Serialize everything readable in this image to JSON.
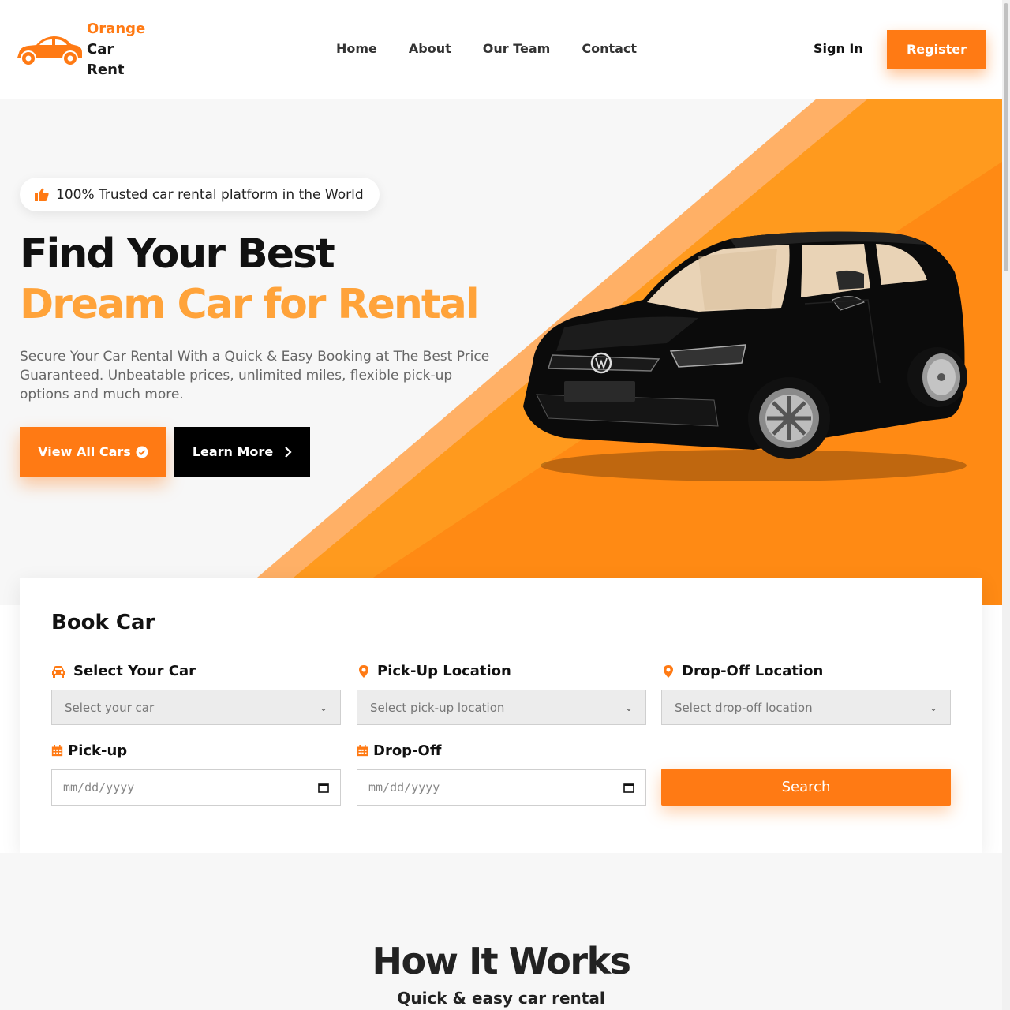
{
  "brand": {
    "line1": "Orange",
    "line2": "Car",
    "line3": "Rent",
    "accent": "#ff7a14"
  },
  "nav": {
    "items": [
      "Home",
      "About",
      "Our Team",
      "Contact"
    ],
    "sign_in": "Sign In",
    "register": "Register"
  },
  "hero": {
    "badge": "100% Trusted car rental platform in the World",
    "title_line1": "Find Your Best",
    "title_line2": "Dream Car for Rental",
    "description": "Secure Your Car Rental With a Quick & Easy Booking at The Best Price Guaranteed. Unbeatable prices, unlimited miles, flexible pick-up options and much more.",
    "btn_view": "View All Cars",
    "btn_learn": "Learn More"
  },
  "book": {
    "title": "Book Car",
    "car_label": "Select Your Car",
    "car_placeholder": "Select your car",
    "pickup_loc_label": "Pick-Up Location",
    "pickup_loc_placeholder": "Select pick-up location",
    "dropoff_loc_label": "Drop-Off Location",
    "dropoff_loc_placeholder": "Select drop-off location",
    "pickup_label": "Pick-up",
    "pickup_date": "mm/dd/yyyy",
    "dropoff_label": "Drop-Off",
    "dropoff_date": "mm/dd/yyyy",
    "search": "Search"
  },
  "how": {
    "title": "How It Works",
    "subtitle": "Quick & easy car rental"
  }
}
